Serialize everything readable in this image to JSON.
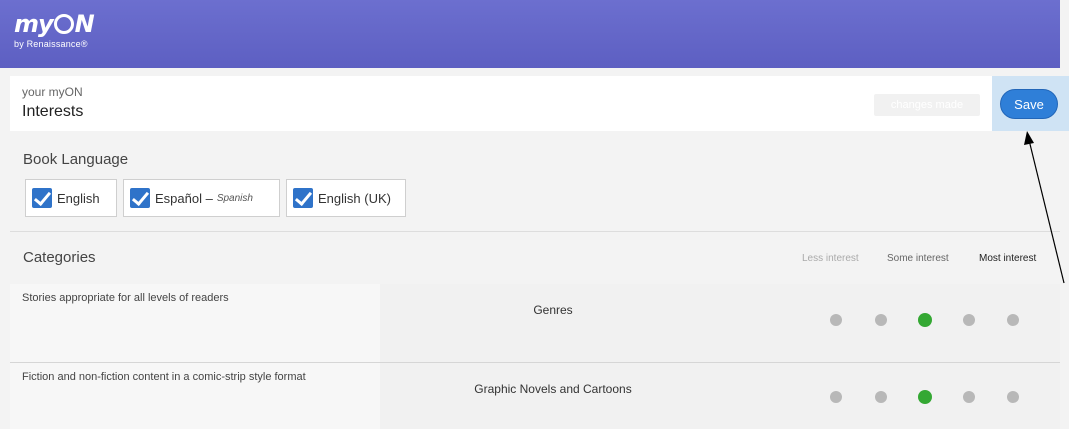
{
  "brand": {
    "logo_text_left": "my",
    "logo_text_right": "N",
    "tagline": "by Renaissance®"
  },
  "header": {
    "kicker": "your myON",
    "title": "Interests",
    "changes_label": "changes made",
    "save_label": "Save"
  },
  "book_language": {
    "title": "Book Language",
    "options": [
      {
        "label": "English",
        "sublabel": "",
        "checked": true
      },
      {
        "label": "Español –",
        "sublabel": "Spanish",
        "checked": true
      },
      {
        "label": "English (UK)",
        "sublabel": "",
        "checked": true
      }
    ]
  },
  "categories": {
    "title": "Categories",
    "scale": [
      "Less interest",
      "Some interest",
      "Most interest"
    ],
    "rows": [
      {
        "description": "Stories appropriate for all levels of readers",
        "name": "Genres",
        "selected_level": 3,
        "levels": 5
      },
      {
        "description": "Fiction and non-fiction content in a comic-strip style format",
        "name": "Graphic Novels and Cartoons",
        "selected_level": 3,
        "levels": 5
      }
    ]
  },
  "colors": {
    "brand_purple": "#6063c8",
    "save_blue": "#2f7fd8",
    "selected_green": "#34a833",
    "unselected_gray": "#b8b8b8"
  }
}
